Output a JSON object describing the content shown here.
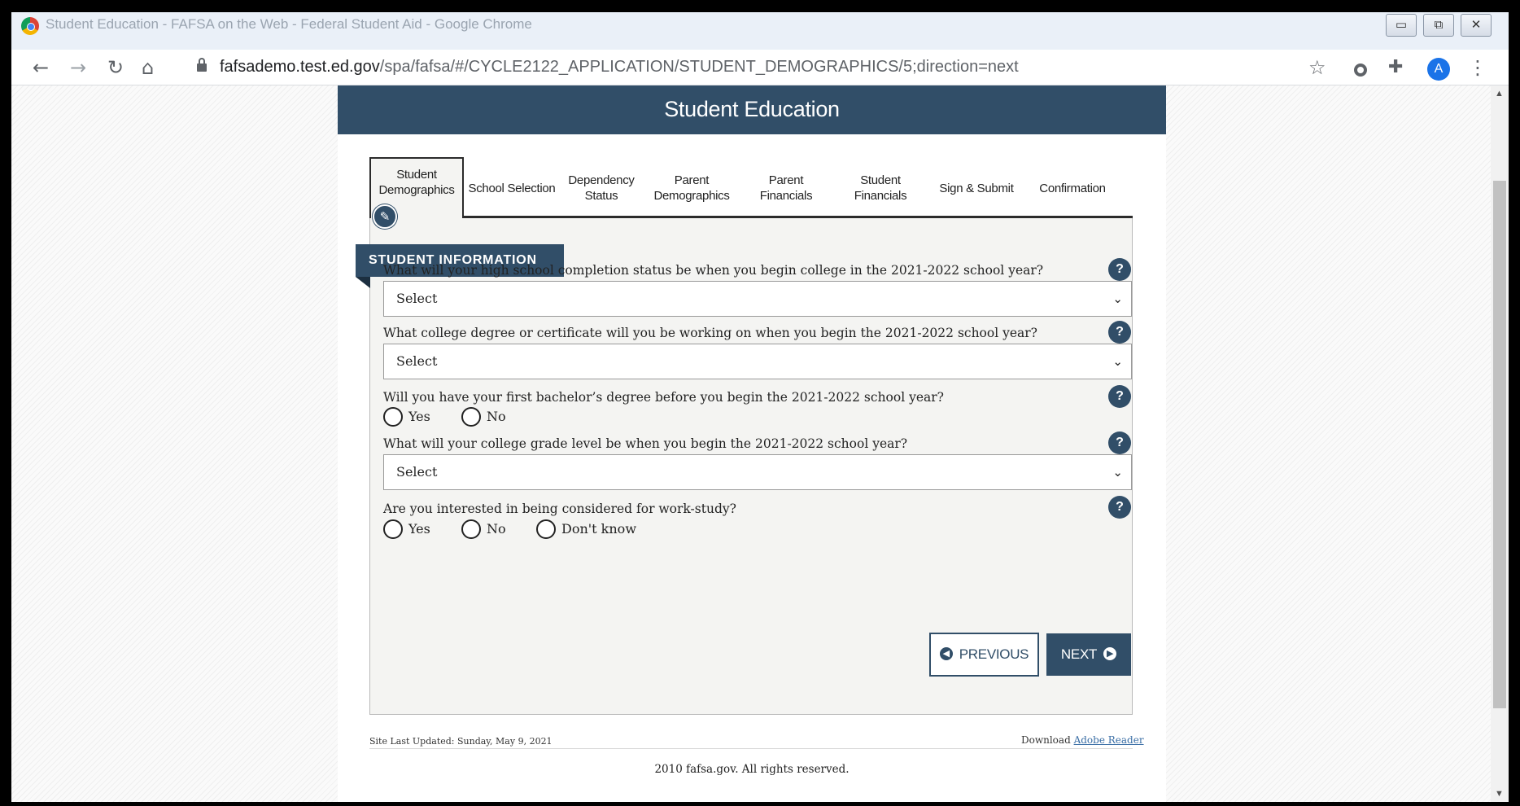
{
  "window": {
    "title": "Student Education - FAFSA on the Web - Federal Student Aid - Google Chrome",
    "controls": [
      "▭",
      "⧉",
      "✕"
    ]
  },
  "browser": {
    "url_host": "fafsademo.test.ed.gov",
    "url_path": "/spa/fafsa/#/CYCLE2122_APPLICATION/STUDENT_DEMOGRAPHICS/5;direction=next",
    "profile_initial": "A",
    "icons": [
      "back-icon",
      "forward-icon",
      "reload-icon",
      "home-icon",
      "lock-icon",
      "star-icon",
      "extension-icon",
      "puzzle-icon",
      "menu-icon"
    ]
  },
  "page": {
    "header": "Student Education",
    "tabs": [
      {
        "line1": "Student",
        "line2": "Demographics",
        "active": true
      },
      {
        "line1": "School Selection",
        "line2": ""
      },
      {
        "line1": "Dependency",
        "line2": "Status"
      },
      {
        "line1": "Parent",
        "line2": "Demographics"
      },
      {
        "line1": "Parent",
        "line2": "Financials"
      },
      {
        "line1": "Student",
        "line2": "Financials"
      },
      {
        "line1": "Sign & Submit",
        "line2": ""
      },
      {
        "line1": "Confirmation",
        "line2": ""
      }
    ],
    "section_title": "STUDENT INFORMATION",
    "questions": {
      "q1": {
        "text": "What will your high school completion status be when you begin college in the 2021-2022 school year?",
        "value": "Select"
      },
      "q2": {
        "text": "What college degree or certificate will you be working on when you begin the 2021-2022 school year?",
        "value": "Select"
      },
      "q3": {
        "text": "Will you have your first bachelor’s degree before you begin the 2021-2022 school year?",
        "options": [
          "Yes",
          "No"
        ]
      },
      "q4": {
        "text": "What will your college grade level be when you begin the 2021-2022 school year?",
        "value": "Select"
      },
      "q5": {
        "text": "Are you interested in being considered for work-study?",
        "options": [
          "Yes",
          "No",
          "Don't know"
        ]
      }
    },
    "help_label": "?",
    "buttons": {
      "previous": "PREVIOUS",
      "next": "NEXT"
    },
    "footer": {
      "updated": "Site Last Updated: Sunday, May 9, 2021",
      "download_prefix": "Download",
      "download_link": "Adobe Reader",
      "copyright": "2010 fafsa.gov. All rights reserved."
    }
  },
  "colors": {
    "brand": "#314e68",
    "link": "#3a6ea5",
    "form_bg": "#f4f4f2"
  }
}
